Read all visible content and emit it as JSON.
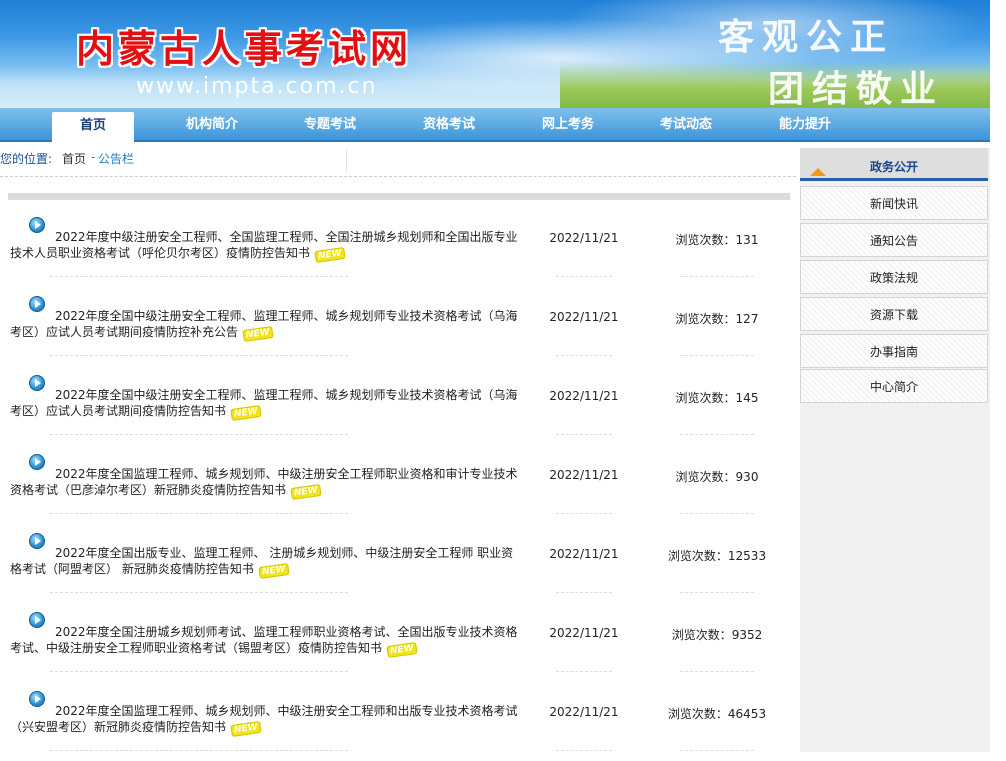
{
  "banner": {
    "title": "内蒙古人事考试网",
    "url": "www.impta.com.cn",
    "slogan_line1": "客观公正",
    "slogan_line2": "团结敬业"
  },
  "nav": {
    "items": [
      "首页",
      "机构简介",
      "专题考试",
      "资格考试",
      "网上考务",
      "考试动态",
      "能力提升"
    ],
    "active": "首页"
  },
  "breadcrumb": {
    "label": "您的位置:",
    "home": "首页",
    "separator": "-",
    "current": "公告栏"
  },
  "articles": [
    {
      "title": "2022年度中级注册安全工程师、全国监理工程师、全国注册城乡规划师和全国出版专业技术人员职业资格考试（呼伦贝尔考区）疫情防控告知书",
      "new_badge": "NEW",
      "date": "2022/11/21",
      "views": "浏览次数：131"
    },
    {
      "title": "2022年度全国中级注册安全工程师、监理工程师、城乡规划师专业技术资格考试（乌海考区）应试人员考试期间疫情防控补充公告",
      "new_badge": "NEW",
      "date": "2022/11/21",
      "views": "浏览次数：127"
    },
    {
      "title": "2022年度全国中级注册安全工程师、监理工程师、城乡规划师专业技术资格考试（乌海考区）应试人员考试期间疫情防控告知书",
      "new_badge": "NEW",
      "date": "2022/11/21",
      "views": "浏览次数：145"
    },
    {
      "title": "2022年度全国监理工程师、城乡规划师、中级注册安全工程师职业资格和审计专业技术资格考试（巴彦淖尔考区）新冠肺炎疫情防控告知书",
      "new_badge": "NEW",
      "date": "2022/11/21",
      "views": "浏览次数：930"
    },
    {
      "title": "2022年度全国出版专业、监理工程师、 注册城乡规划师、中级注册安全工程师 职业资格考试（阿盟考区） 新冠肺炎疫情防控告知书",
      "new_badge": "NEW",
      "date": "2022/11/21",
      "views": "浏览次数：12533"
    },
    {
      "title": "2022年度全国注册城乡规划师考试、监理工程师职业资格考试、全国出版专业技术资格考试、中级注册安全工程师职业资格考试（锡盟考区）疫情防控告知书",
      "new_badge": "NEW",
      "date": "2022/11/21",
      "views": "浏览次数：9352"
    },
    {
      "title": "2022年度全国监理工程师、城乡规划师、中级注册安全工程师和出版专业技术资格考试（兴安盟考区）新冠肺炎疫情防控告知书",
      "new_badge": "NEW",
      "date": "2022/11/21",
      "views": "浏览次数：46453"
    }
  ],
  "sidebar": {
    "heading": "政务公开",
    "items": [
      "新闻快讯",
      "通知公告",
      "政策法规",
      "资源下载",
      "办事指南",
      "中心简介"
    ]
  },
  "colors": {
    "nav_blue": "#3d95d9",
    "title_red": "#e30f12",
    "sidebar_accent": "#2b5ea8",
    "link_blue": "#1a7fd0",
    "new_badge": "#f2e41a"
  },
  "icons": {
    "bullet": "circle-arrow-icon",
    "sidebar_tab": "orange-triangle-icon"
  }
}
